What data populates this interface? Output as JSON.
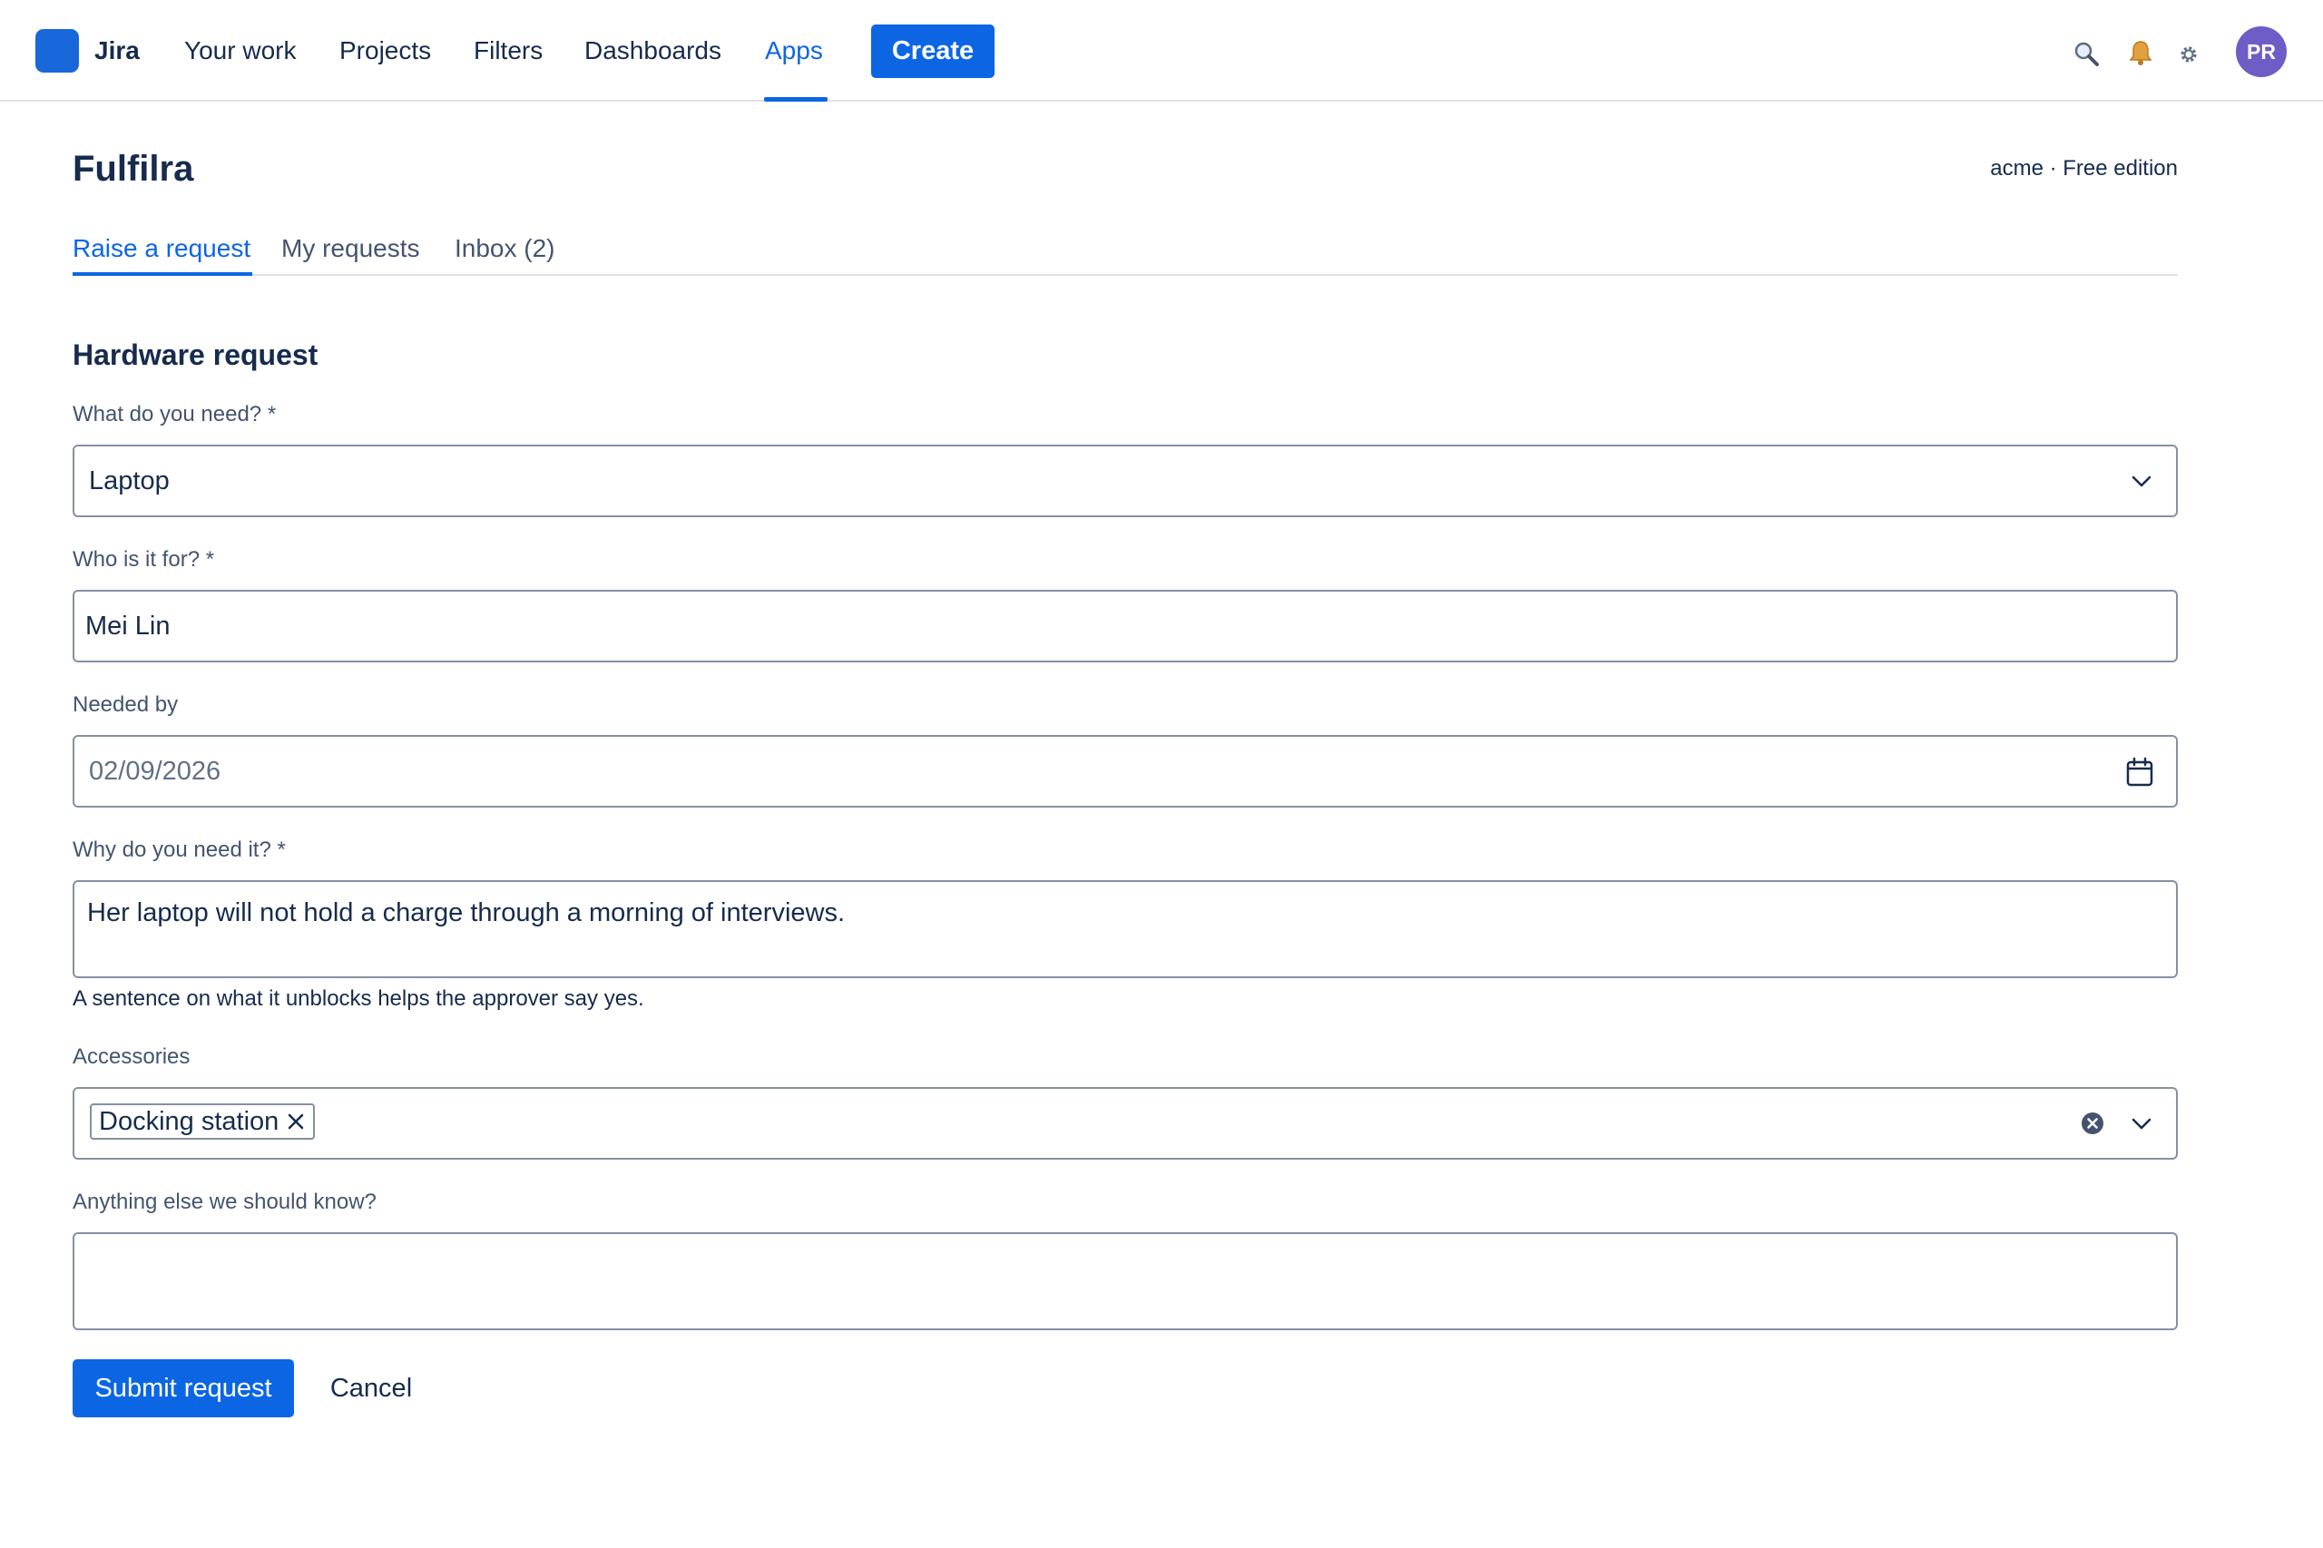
{
  "app": {
    "brand": "Jira",
    "nav": [
      {
        "label": "Your work",
        "active": false
      },
      {
        "label": "Projects",
        "active": false
      },
      {
        "label": "Filters",
        "active": false
      },
      {
        "label": "Dashboards",
        "active": false
      },
      {
        "label": "Apps",
        "active": true
      }
    ],
    "create_label": "Create",
    "icons": [
      "search-icon",
      "bell-icon",
      "gear-icon"
    ],
    "avatar_initials": "PR",
    "accent_color": "#0c66e4",
    "avatar_color": "#6e5dc6"
  },
  "page": {
    "title": "Fulfilra",
    "edition": "acme · Free edition",
    "tabs": [
      {
        "label": "Raise a request",
        "active": true
      },
      {
        "label": "My requests",
        "active": false
      },
      {
        "label": "Inbox (2)",
        "active": false
      }
    ]
  },
  "form": {
    "title": "Hardware request",
    "need": {
      "label": "What do you need? *",
      "value": "Laptop",
      "icon": "chevron-down-icon"
    },
    "for": {
      "label": "Who is it for? *",
      "value": "Mei Lin"
    },
    "needed_by": {
      "label": "Needed by",
      "value": "02/09/2026",
      "icon": "calendar-icon"
    },
    "why": {
      "label": "Why do you need it? *",
      "value": "Her laptop will not hold a charge through a morning of interviews.",
      "helper": "A sentence on what it unblocks helps the approver say yes."
    },
    "accessories": {
      "label": "Accessories",
      "tags": [
        "Docking station"
      ],
      "icons": [
        "close-icon",
        "clear-icon",
        "chevron-down-icon"
      ]
    },
    "notes": {
      "label": "Anything else we should know?",
      "value": ""
    },
    "submit_label": "Submit request",
    "cancel_label": "Cancel"
  }
}
